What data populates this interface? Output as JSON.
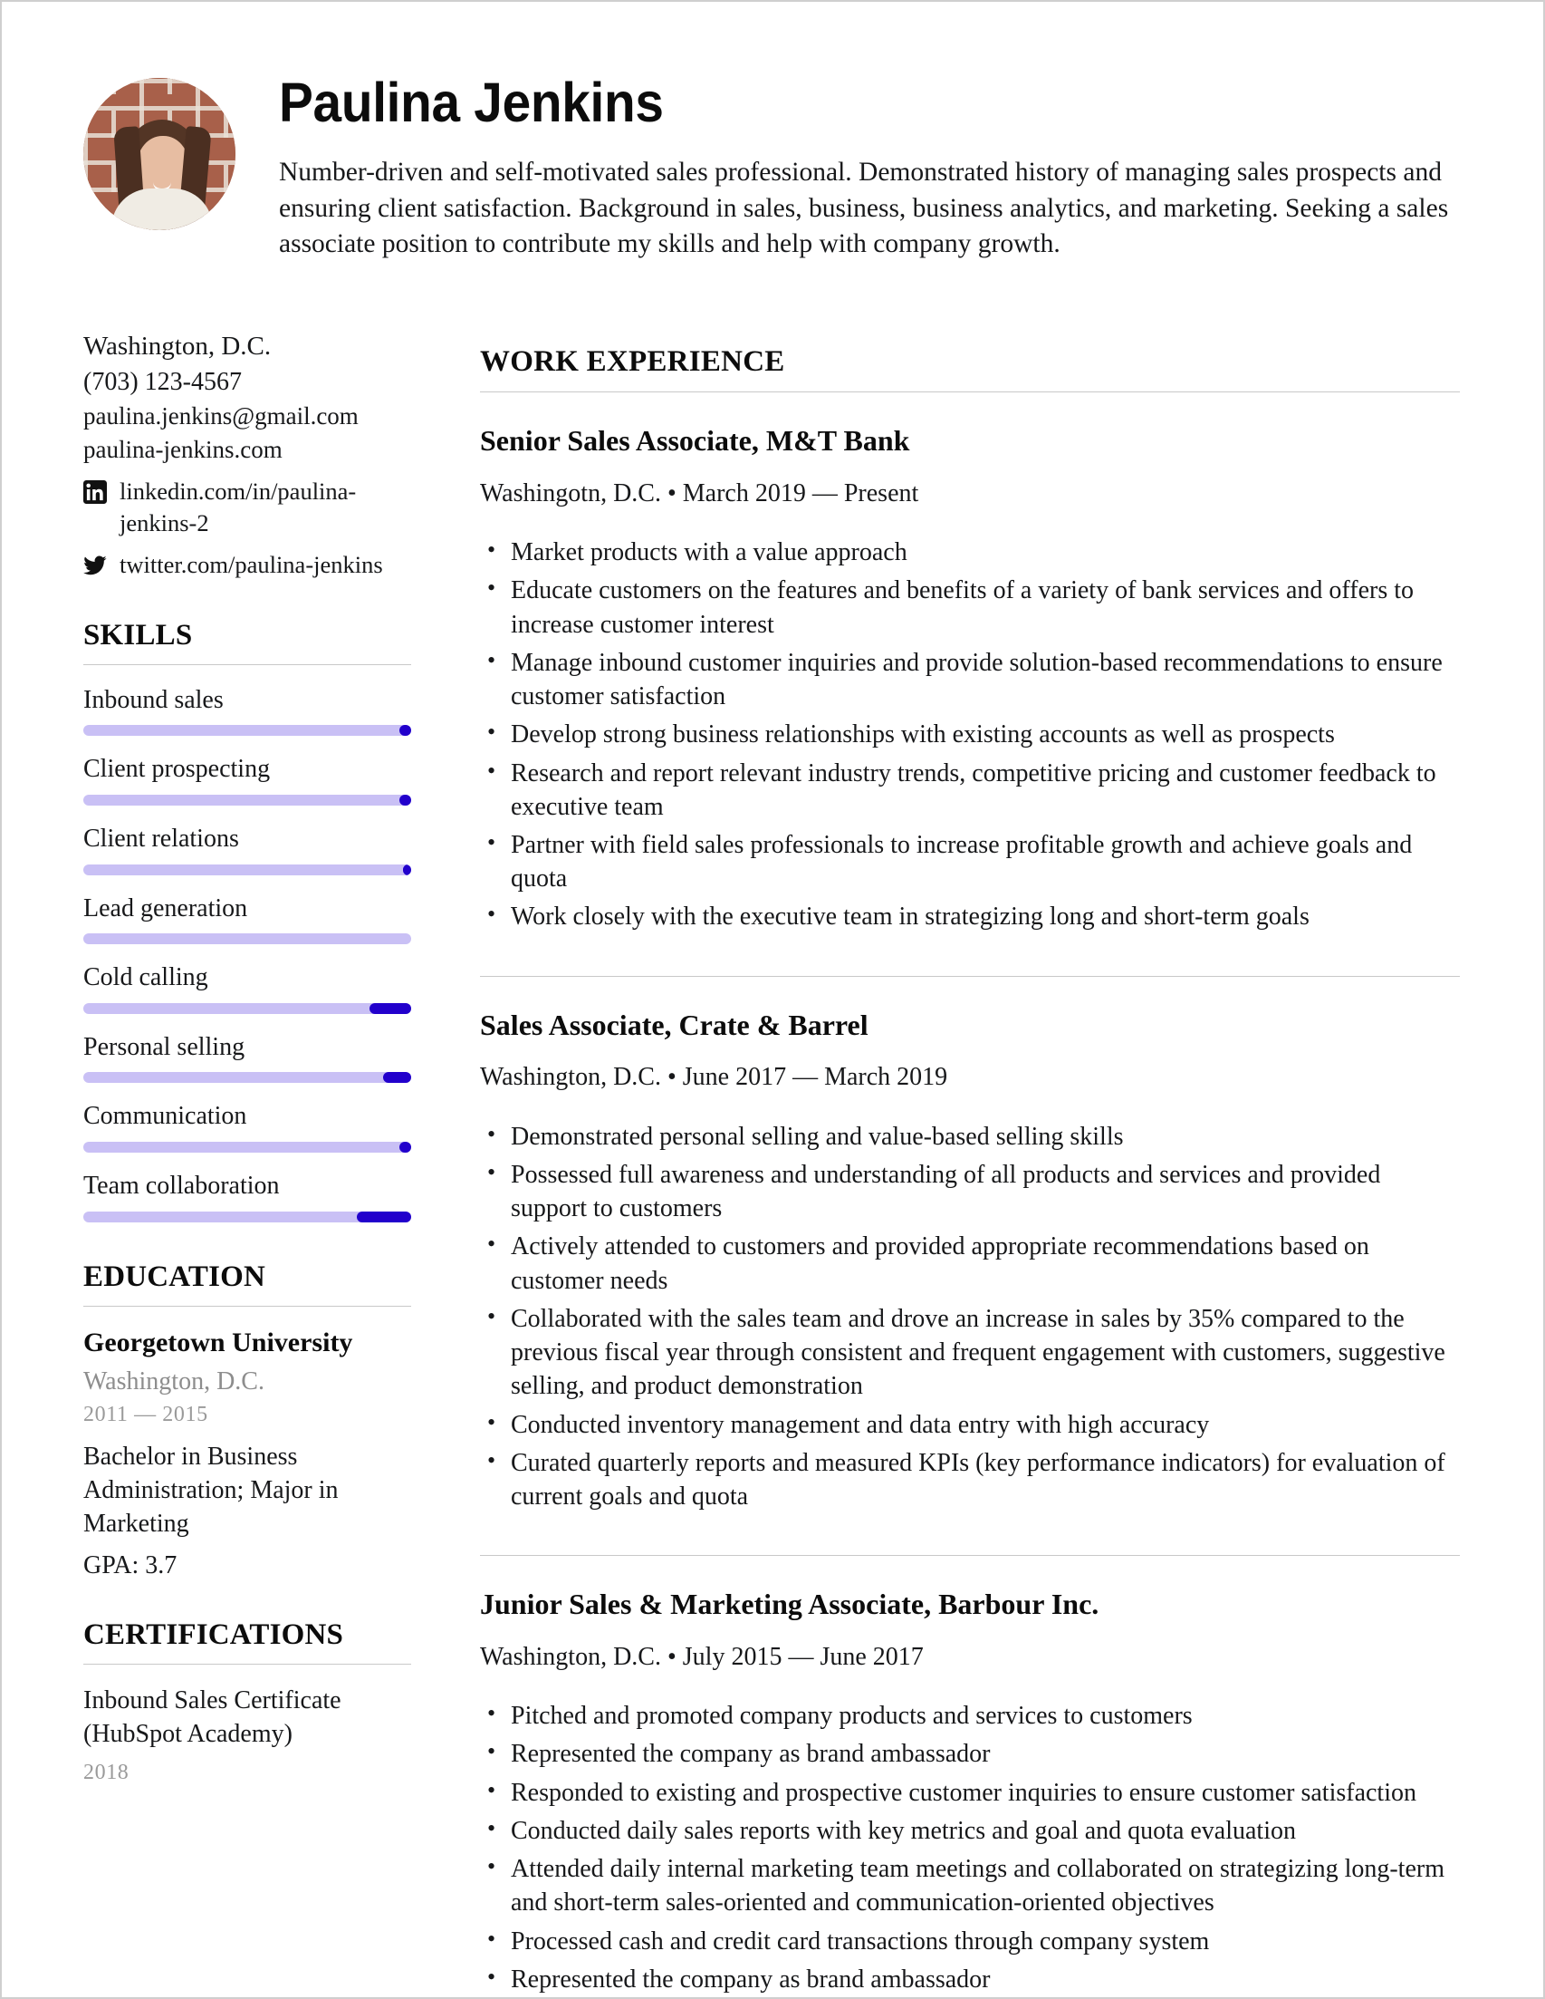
{
  "colors": {
    "skill_track": "#c9c0f5",
    "skill_fill": "#2200cc",
    "rule": "#c9c9c9",
    "text": "#17181a",
    "muted": "#9a9a9a"
  },
  "header": {
    "name": "Paulina Jenkins",
    "summary": "Number-driven and self-motivated sales professional. Demonstrated history of managing sales prospects and ensuring client satisfaction. Background in sales, business, business analytics, and marketing. Seeking a sales associate position to contribute my skills and help with company growth.",
    "avatar_alt": "profile-photo"
  },
  "contact": {
    "location": "Washington, D.C.",
    "phone": "(703) 123-4567",
    "email": "paulina.jenkins@gmail.com",
    "website": "paulina-jenkins.com",
    "social": [
      {
        "icon": "linkedin-icon",
        "label": "linkedin.com/in/paulina-jenkins-2"
      },
      {
        "icon": "twitter-icon",
        "label": "twitter.com/paulina-jenkins"
      }
    ]
  },
  "skills": {
    "title": "SKILLS",
    "items": [
      {
        "label": "Inbound sales",
        "level": 97
      },
      {
        "label": "Client prospecting",
        "level": 97
      },
      {
        "label": "Client relations",
        "level": 98
      },
      {
        "label": "Lead generation",
        "level": 100
      },
      {
        "label": "Cold calling",
        "level": 88
      },
      {
        "label": "Personal selling",
        "level": 92
      },
      {
        "label": "Communication",
        "level": 97
      },
      {
        "label": "Team collaboration",
        "level": 84
      }
    ]
  },
  "education": {
    "title": "EDUCATION",
    "school": "Georgetown University",
    "location": "Washington, D.C.",
    "years": "2011 — 2015",
    "degree": "Bachelor in Business Administration; Major in Marketing",
    "gpa": "GPA: 3.7"
  },
  "certifications": {
    "title": "CERTIFICATIONS",
    "items": [
      {
        "name": "Inbound Sales Certificate (HubSpot Academy)",
        "year": "2018"
      }
    ]
  },
  "work": {
    "title": "WORK EXPERIENCE",
    "jobs": [
      {
        "title": "Senior Sales Associate, M&T Bank",
        "meta": "Washingotn, D.C. • March 2019 — Present",
        "bullets": [
          "Market products with a value approach",
          "Educate customers on the features and benefits of a variety of bank services and offers to increase customer interest",
          "Manage inbound customer inquiries and provide solution-based recommendations to ensure customer satisfaction",
          "Develop strong business relationships with existing accounts as well as prospects",
          "Research and report relevant industry trends, competitive pricing and customer feedback to executive team",
          "Partner with field sales professionals to increase profitable growth and achieve goals and quota",
          "Work closely with the executive team in strategizing long and short-term goals"
        ]
      },
      {
        "title": "Sales Associate, Crate & Barrel",
        "meta": "Washington, D.C. • June 2017 — March 2019",
        "bullets": [
          "Demonstrated personal selling and value-based selling skills",
          "Possessed full awareness and understanding of all products and services and provided support to customers",
          "Actively attended to customers and provided appropriate recommendations based on customer needs",
          "Collaborated with the sales team and drove an increase in sales by 35% compared to the previous fiscal year through consistent and frequent engagement with customers, suggestive selling, and product demonstration",
          "Conducted inventory management and data entry with high accuracy",
          "Curated quarterly reports and measured KPIs (key performance indicators) for evaluation of current goals and quota"
        ]
      },
      {
        "title": "Junior Sales & Marketing Associate, Barbour Inc.",
        "meta": "Washington, D.C. • July 2015 — June 2017",
        "bullets": [
          "Pitched and promoted company products and services to customers",
          "Represented the company as brand ambassador",
          "Responded to existing and prospective customer inquiries to ensure customer satisfaction",
          "Conducted daily sales reports with key metrics and goal and quota evaluation",
          "Attended daily internal marketing team meetings and collaborated on strategizing long-term and short-term sales-oriented and communication-oriented objectives",
          "Processed cash and credit card transactions through company system",
          "Represented the company as brand ambassador"
        ]
      }
    ]
  }
}
